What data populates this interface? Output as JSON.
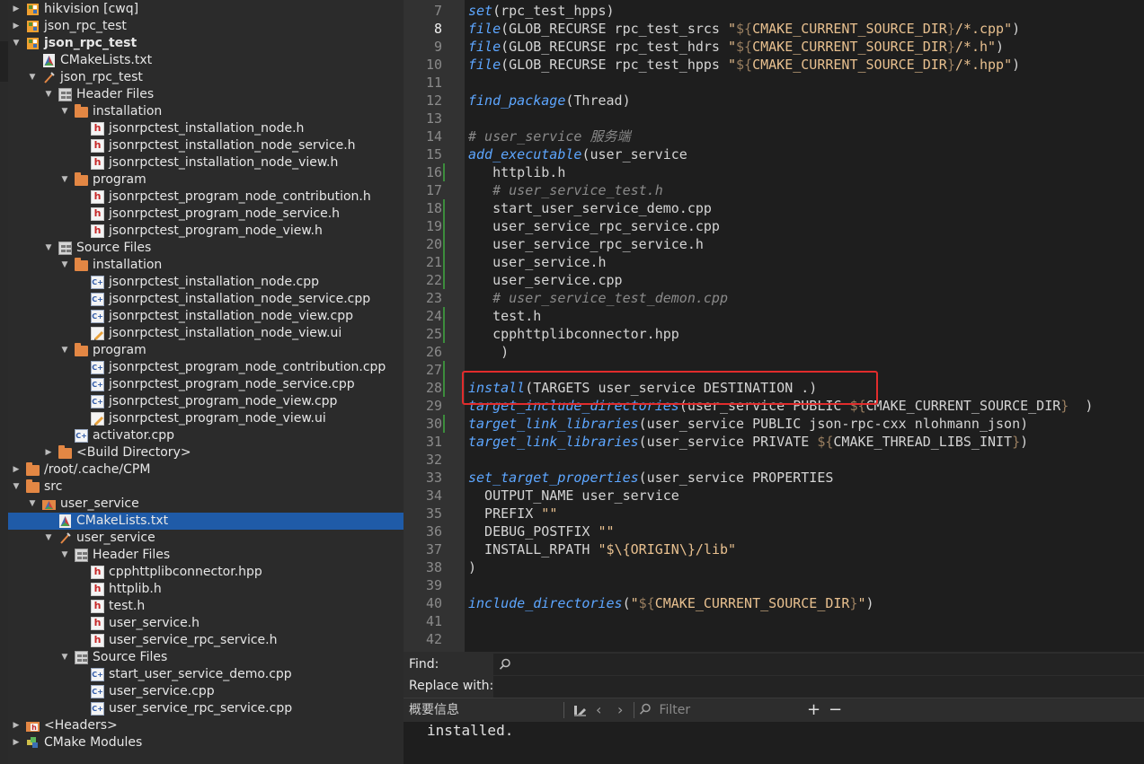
{
  "project_tree": {
    "rows": [
      {
        "label": "hikvision [cwq]",
        "icon": "project-icon",
        "state": "collapsed",
        "bold": false
      },
      {
        "label": "json_rpc_test",
        "icon": "project-icon",
        "state": "collapsed",
        "bold": false
      },
      {
        "label": "json_rpc_test",
        "icon": "project-icon",
        "state": "expanded",
        "bold": true
      },
      {
        "label": "CMakeLists.txt",
        "icon": "cmake-file-icon",
        "state": "none",
        "bold": false
      },
      {
        "label": "json_rpc_test",
        "icon": "build-target-icon",
        "state": "expanded",
        "bold": false
      },
      {
        "label": "Header Files",
        "icon": "header-group-icon",
        "state": "expanded",
        "bold": false
      },
      {
        "label": "installation",
        "icon": "folder-icon",
        "state": "expanded",
        "bold": false
      },
      {
        "label": "jsonrpctest_installation_node.h",
        "icon": "h-file-icon",
        "state": "none",
        "bold": false
      },
      {
        "label": "jsonrpctest_installation_node_service.h",
        "icon": "h-file-icon",
        "state": "none",
        "bold": false
      },
      {
        "label": "jsonrpctest_installation_node_view.h",
        "icon": "h-file-icon",
        "state": "none",
        "bold": false
      },
      {
        "label": "program",
        "icon": "folder-icon",
        "state": "expanded",
        "bold": false
      },
      {
        "label": "jsonrpctest_program_node_contribution.h",
        "icon": "h-file-icon",
        "state": "none",
        "bold": false
      },
      {
        "label": "jsonrpctest_program_node_service.h",
        "icon": "h-file-icon",
        "state": "none",
        "bold": false
      },
      {
        "label": "jsonrpctest_program_node_view.h",
        "icon": "h-file-icon",
        "state": "none",
        "bold": false
      },
      {
        "label": "Source Files",
        "icon": "source-group-icon",
        "state": "expanded",
        "bold": false
      },
      {
        "label": "installation",
        "icon": "folder-icon",
        "state": "expanded",
        "bold": false
      },
      {
        "label": "jsonrpctest_installation_node.cpp",
        "icon": "cpp-file-icon",
        "state": "none",
        "bold": false
      },
      {
        "label": "jsonrpctest_installation_node_service.cpp",
        "icon": "cpp-file-icon",
        "state": "none",
        "bold": false
      },
      {
        "label": "jsonrpctest_installation_node_view.cpp",
        "icon": "cpp-file-icon",
        "state": "none",
        "bold": false
      },
      {
        "label": "jsonrpctest_installation_node_view.ui",
        "icon": "ui-file-icon",
        "state": "none",
        "bold": false
      },
      {
        "label": "program",
        "icon": "folder-icon",
        "state": "expanded",
        "bold": false
      },
      {
        "label": "jsonrpctest_program_node_contribution.cpp",
        "icon": "cpp-file-icon",
        "state": "none",
        "bold": false
      },
      {
        "label": "jsonrpctest_program_node_service.cpp",
        "icon": "cpp-file-icon",
        "state": "none",
        "bold": false
      },
      {
        "label": "jsonrpctest_program_node_view.cpp",
        "icon": "cpp-file-icon",
        "state": "none",
        "bold": false
      },
      {
        "label": "jsonrpctest_program_node_view.ui",
        "icon": "ui-file-icon",
        "state": "none",
        "bold": false
      },
      {
        "label": "activator.cpp",
        "icon": "cpp-file-icon",
        "state": "none",
        "bold": false
      },
      {
        "label": "<Build Directory>",
        "icon": "folder-icon",
        "state": "collapsed",
        "bold": false
      },
      {
        "label": "/root/.cache/CPM",
        "icon": "folder-icon",
        "state": "collapsed",
        "bold": false
      },
      {
        "label": "src",
        "icon": "folder-icon",
        "state": "expanded",
        "bold": false
      },
      {
        "label": "user_service",
        "icon": "cmake-folder-icon",
        "state": "expanded",
        "bold": false
      },
      {
        "label": "CMakeLists.txt",
        "icon": "cmake-file-icon",
        "state": "none",
        "bold": false,
        "selected": true
      },
      {
        "label": "user_service",
        "icon": "build-target-icon",
        "state": "expanded",
        "bold": false
      },
      {
        "label": "Header Files",
        "icon": "header-group-icon",
        "state": "expanded",
        "bold": false
      },
      {
        "label": "cpphttplibconnector.hpp",
        "icon": "h-file-icon",
        "state": "none",
        "bold": false
      },
      {
        "label": "httplib.h",
        "icon": "h-file-icon",
        "state": "none",
        "bold": false
      },
      {
        "label": "test.h",
        "icon": "h-file-icon",
        "state": "none",
        "bold": false
      },
      {
        "label": "user_service.h",
        "icon": "h-file-icon",
        "state": "none",
        "bold": false
      },
      {
        "label": "user_service_rpc_service.h",
        "icon": "h-file-icon",
        "state": "none",
        "bold": false
      },
      {
        "label": "Source Files",
        "icon": "source-group-icon",
        "state": "expanded",
        "bold": false
      },
      {
        "label": "start_user_service_demo.cpp",
        "icon": "cpp-file-icon",
        "state": "none",
        "bold": false
      },
      {
        "label": "user_service.cpp",
        "icon": "cpp-file-icon",
        "state": "none",
        "bold": false
      },
      {
        "label": "user_service_rpc_service.cpp",
        "icon": "cpp-file-icon",
        "state": "none",
        "bold": false
      },
      {
        "label": "<Headers>",
        "icon": "headers-folder-icon",
        "state": "collapsed",
        "bold": false
      },
      {
        "label": "CMake Modules",
        "icon": "cmake-modules-icon",
        "state": "collapsed",
        "bold": false
      }
    ]
  },
  "editor": {
    "current_line": 8,
    "lines": [
      {
        "n": 7,
        "text": "set(rpc_test_hpps)",
        "modified": false
      },
      {
        "n": 8,
        "text": "file(GLOB_RECURSE rpc_test_srcs \"${CMAKE_CURRENT_SOURCE_DIR}/*.cpp\")",
        "modified": false
      },
      {
        "n": 9,
        "text": "file(GLOB_RECURSE rpc_test_hdrs \"${CMAKE_CURRENT_SOURCE_DIR}/*.h\")",
        "modified": false
      },
      {
        "n": 10,
        "text": "file(GLOB_RECURSE rpc_test_hpps \"${CMAKE_CURRENT_SOURCE_DIR}/*.hpp\")",
        "modified": false
      },
      {
        "n": 11,
        "text": "",
        "modified": false
      },
      {
        "n": 12,
        "text": "find_package(Thread)",
        "modified": false
      },
      {
        "n": 13,
        "text": "",
        "modified": false
      },
      {
        "n": 14,
        "text": "# user_service 服务端",
        "modified": false
      },
      {
        "n": 15,
        "text": "add_executable(user_service",
        "modified": false
      },
      {
        "n": 16,
        "text": "   httplib.h",
        "modified": true
      },
      {
        "n": 17,
        "text": "   # user_service_test.h",
        "modified": false
      },
      {
        "n": 18,
        "text": "   start_user_service_demo.cpp",
        "modified": true
      },
      {
        "n": 19,
        "text": "   user_service_rpc_service.cpp",
        "modified": true
      },
      {
        "n": 20,
        "text": "   user_service_rpc_service.h",
        "modified": true
      },
      {
        "n": 21,
        "text": "   user_service.h",
        "modified": true
      },
      {
        "n": 22,
        "text": "   user_service.cpp",
        "modified": true
      },
      {
        "n": 23,
        "text": "   # user_service_test_demon.cpp",
        "modified": false
      },
      {
        "n": 24,
        "text": "   test.h",
        "modified": true
      },
      {
        "n": 25,
        "text": "   cpphttplibconnector.hpp",
        "modified": true
      },
      {
        "n": 26,
        "text": "    )",
        "modified": false
      },
      {
        "n": 27,
        "text": "",
        "modified": true
      },
      {
        "n": 28,
        "text": "install(TARGETS user_service DESTINATION .)",
        "modified": true
      },
      {
        "n": 29,
        "text": "target_include_directories(user_service PUBLIC ${CMAKE_CURRENT_SOURCE_DIR}  )",
        "modified": false
      },
      {
        "n": 30,
        "text": "target_link_libraries(user_service PUBLIC json-rpc-cxx nlohmann_json)",
        "modified": true
      },
      {
        "n": 31,
        "text": "target_link_libraries(user_service PRIVATE ${CMAKE_THREAD_LIBS_INIT})",
        "modified": false
      },
      {
        "n": 32,
        "text": "",
        "modified": false
      },
      {
        "n": 33,
        "text": "set_target_properties(user_service PROPERTIES",
        "modified": false
      },
      {
        "n": 34,
        "text": "  OUTPUT_NAME user_service",
        "modified": false
      },
      {
        "n": 35,
        "text": "  PREFIX \"\"",
        "modified": false
      },
      {
        "n": 36,
        "text": "  DEBUG_POSTFIX \"\"",
        "modified": false
      },
      {
        "n": 37,
        "text": "  INSTALL_RPATH \"$\\{ORIGIN\\}/lib\"",
        "modified": false
      },
      {
        "n": 38,
        "text": ")",
        "modified": false
      },
      {
        "n": 39,
        "text": "",
        "modified": false
      },
      {
        "n": 40,
        "text": "include_directories(\"${CMAKE_CURRENT_SOURCE_DIR}\")",
        "modified": false
      },
      {
        "n": 41,
        "text": "",
        "modified": false
      },
      {
        "n": 42,
        "text": "",
        "modified": false
      }
    ]
  },
  "find_bar": {
    "find_label": "Find:",
    "replace_label": "Replace with:",
    "find_value": "",
    "replace_value": ""
  },
  "output_pane": {
    "title": "概要信息",
    "filter_placeholder": "Filter",
    "content": "installed."
  },
  "colors": {
    "selection": "#1f5ba8",
    "highlight_box": "#e12c2c",
    "keyword": "#5da6ff",
    "string": "#e8c08f",
    "comment": "#8a8a8a",
    "modified_marker": "#3c8c3c"
  }
}
